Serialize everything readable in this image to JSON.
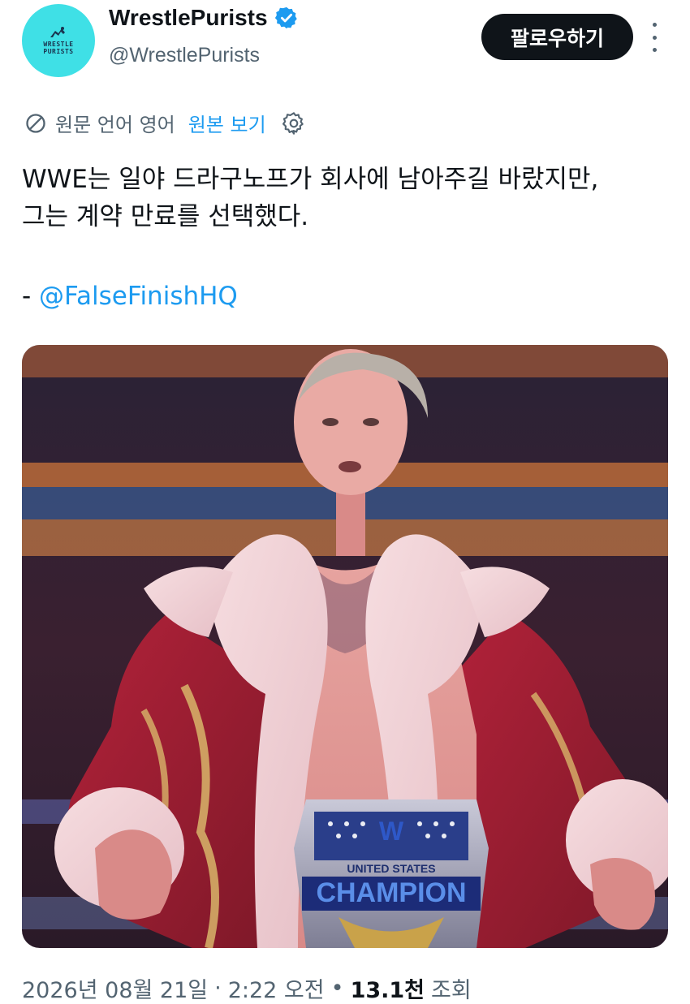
{
  "account": {
    "display_name": "WrestlePurists",
    "handle": "@WrestlePurists",
    "avatar_text_line1": "WRESTLE",
    "avatar_text_line2": "PURISTS",
    "verified_icon": "verified-badge-icon",
    "avatar_color": "#3fe0e6"
  },
  "actions": {
    "follow_label": "팔로우하기",
    "more_icon": "more-vertical-icon"
  },
  "translation": {
    "original_language_label": "원문 언어 영어",
    "show_original_label": "원본 보기",
    "globe_icon": "translate-globe-icon",
    "settings_icon": "gear-icon"
  },
  "tweet": {
    "text_line1": "WWE는 일야 드라구노프가 회사에 남아주길 바랐지만,",
    "text_line2": "그는 계약 만료를 선택했다.",
    "credit_prefix": "- ",
    "credit_mention": "@FalseFinishHQ",
    "belt_text": "CHAMPION",
    "belt_subtext": "UNITED STATES"
  },
  "meta": {
    "date": "2026년 08월 21일",
    "sep1": "·",
    "time": "2:22 오전",
    "sep2": "•",
    "views_count": "13.1천",
    "views_label": "조회"
  },
  "colors": {
    "link": "#1d9bf0",
    "text": "#0f1419",
    "secondary": "#536471",
    "follow_bg": "#0f1419"
  }
}
